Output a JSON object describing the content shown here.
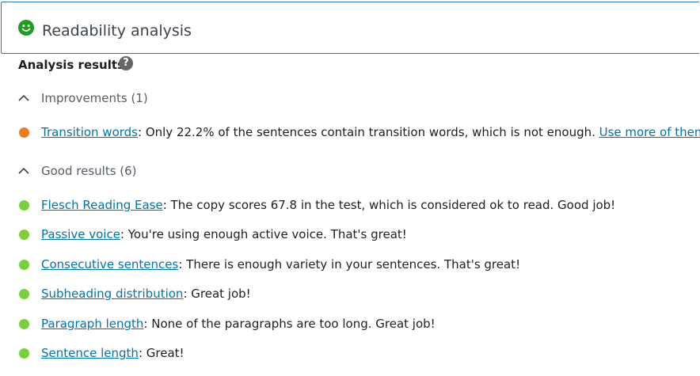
{
  "header": {
    "title": "Readability analysis",
    "status_color": "#1d9e20",
    "icon": "smiley-icon"
  },
  "analysis": {
    "title": "Analysis results",
    "help_icon": "?"
  },
  "improvements": {
    "label": "Improvements (1)",
    "items": [
      {
        "link": "Transition words",
        "text": ": Only 22.2% of the sentences contain transition words, which is not enough. ",
        "extra_link": "Use more of them",
        "trailing": ".",
        "color": "#ee7c1b"
      }
    ]
  },
  "good": {
    "label": "Good results (6)",
    "items": [
      {
        "link": "Flesch Reading Ease",
        "text": ": The copy scores 67.8 in the test, which is considered ok to read. Good job!",
        "color": "#7ad03a"
      },
      {
        "link": "Passive voice",
        "text": ": You're using enough active voice. That's great!",
        "color": "#7ad03a"
      },
      {
        "link": "Consecutive sentences",
        "text": ": There is enough variety in your sentences. That's great!",
        "color": "#7ad03a"
      },
      {
        "link": "Subheading distribution",
        "text": ": Great job!",
        "color": "#7ad03a"
      },
      {
        "link": "Paragraph length",
        "text": ": None of the paragraphs are too long. Great job!",
        "color": "#7ad03a"
      },
      {
        "link": "Sentence length",
        "text": ": Great!",
        "color": "#7ad03a"
      }
    ]
  }
}
